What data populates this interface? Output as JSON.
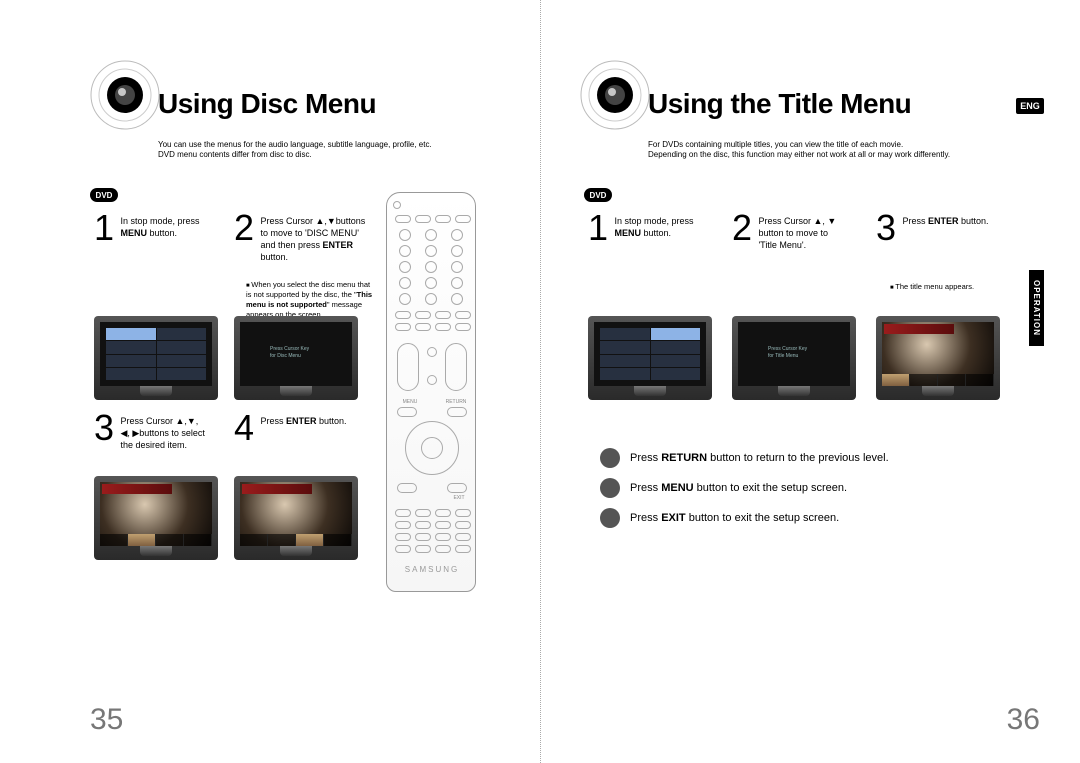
{
  "left": {
    "title": "Using Disc Menu",
    "subtitle_a": "You can use the menus for the audio language, subtitle language, profile, etc.",
    "subtitle_b": "DVD menu contents differ from disc to disc.",
    "badge_dvd": "DVD",
    "steps": {
      "1": {
        "num": "1",
        "text_a": "In stop mode, press",
        "text_b": "MENU",
        "text_c": " button."
      },
      "2": {
        "num": "2",
        "text_a": "Press Cursor ▲,▼buttons",
        "text_b": "to move to 'DISC MENU'",
        "text_c": "and then press ",
        "text_d": "ENTER",
        "text_e": "button."
      },
      "3": {
        "num": "3",
        "text_a": "Press Cursor ▲,▼,",
        "text_b": "◀, ▶buttons to select",
        "text_c": "the desired item."
      },
      "4": {
        "num": "4",
        "text_a": "Press ",
        "text_b": "ENTER",
        "text_c": " button."
      }
    },
    "note2": "When you select the disc menu that is not supported by the disc, the \"This menu is not supported\" message appears on the screen.",
    "note2_bold": "This menu is not supported",
    "tv_menu_text": "Press Cursor Key\nfor Disc Menu",
    "page_num": "35"
  },
  "right": {
    "title": "Using the Title Menu",
    "subtitle_a": "For DVDs containing multiple titles, you can view the title of each movie.",
    "subtitle_b": "Depending on the disc, this function may either not work at all or may work differently.",
    "badge_eng": "ENG",
    "badge_dvd": "DVD",
    "side_tab": "OPERATION",
    "steps": {
      "1": {
        "num": "1",
        "text_a": "In stop mode, press",
        "text_b": "MENU",
        "text_c": " button."
      },
      "2": {
        "num": "2",
        "text_a": "Press Cursor ▲, ▼",
        "text_b": "button to move to",
        "text_c": "'Title Menu'."
      },
      "3": {
        "num": "3",
        "text_a": "Press ",
        "text_b": "ENTER",
        "text_c": " button."
      }
    },
    "note3": "The title menu appears.",
    "tv_menu_text": "Press Cursor Key\nfor Title Menu",
    "hints": {
      "a": {
        "pre": "Press ",
        "bold": "RETURN",
        "post": " button to return to the previous level."
      },
      "b": {
        "pre": "Press ",
        "bold": "MENU",
        "post": " button to exit the setup screen."
      },
      "c": {
        "pre": "Press ",
        "bold": "EXIT",
        "post": " button to exit the setup screen."
      }
    },
    "page_num": "36"
  },
  "remote_brand": "SAMSUNG"
}
